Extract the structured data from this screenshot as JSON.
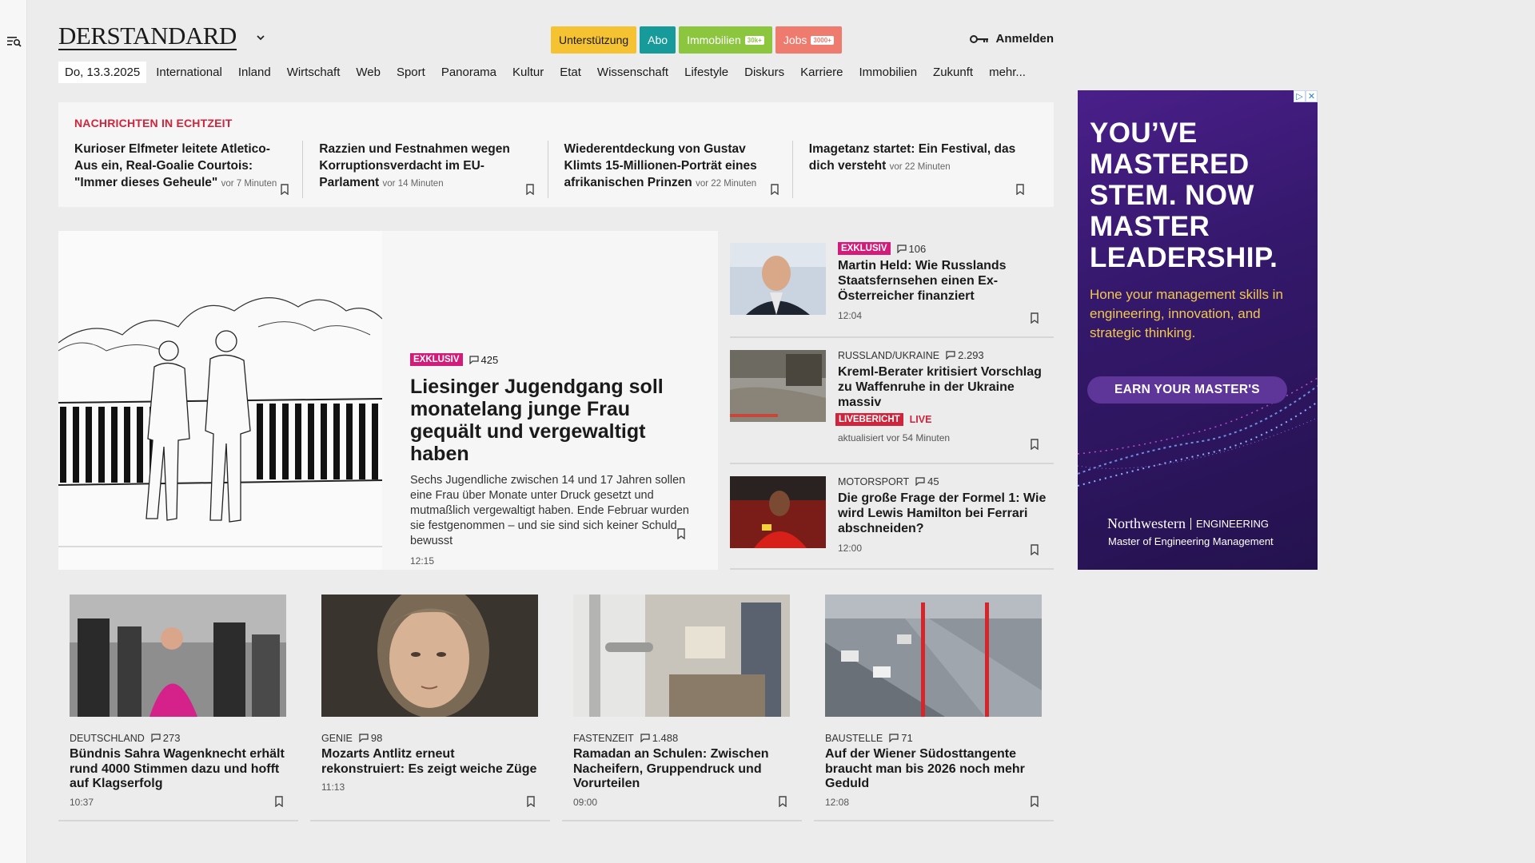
{
  "header": {
    "logo": "DERSTANDARD",
    "pills": [
      {
        "label": "Unterstützung",
        "bg": "#f5c332",
        "fg": "#1a1a1a",
        "tag": ""
      },
      {
        "label": "Abo",
        "bg": "#179a9a",
        "fg": "#ffffff",
        "tag": ""
      },
      {
        "label": "Immobilien",
        "bg": "#8cc63f",
        "fg": "#ffffff",
        "tag": "30k+"
      },
      {
        "label": "Jobs",
        "bg": "#ef7a6e",
        "fg": "#ffffff",
        "tag": "3000+"
      }
    ],
    "login_label": "Anmelden"
  },
  "nav": {
    "date": "Do, 13.3.2025",
    "items": [
      "International",
      "Inland",
      "Wirtschaft",
      "Web",
      "Sport",
      "Panorama",
      "Kultur",
      "Etat",
      "Wissenschaft",
      "Lifestyle",
      "Diskurs",
      "Karriere",
      "Immobilien",
      "Zukunft",
      "mehr..."
    ]
  },
  "ticker": {
    "title": "NACHRICHTEN IN ECHTZEIT",
    "items": [
      {
        "title": "Kurioser Elfmeter leitete Atletico-Aus ein, Real-Goalie Courtois: \"Immer dieses Geheule\"",
        "time": "vor 7 Minuten"
      },
      {
        "title": "Razzien und Festnahmen wegen Korruptionsverdacht im EU-Parlament",
        "time": "vor 14 Minuten"
      },
      {
        "title": "Wiederentdeckung von Gustav Klimts 15-Millionen-Porträt eines afrikanischen Prinzen",
        "time": "vor 22 Minuten"
      },
      {
        "title": "Imagetanz startet: Ein Festival, das dich versteht",
        "time": "vor 22 Minuten"
      }
    ]
  },
  "lead": {
    "badge": "EXKLUSIV",
    "comments": "425",
    "title": "Liesinger Jugendgang soll monatelang junge Frau gequält und vergewaltigt haben",
    "teaser": "Sechs Jugendliche zwischen 14 und 17 Jahren sollen eine Frau über Monate unter Druck gesetzt und mutmaßlich vergewaltigt haben. Ende Februar wurden sie festgenommen – und sie sind sich keiner Schuld bewusst",
    "time": "12:15"
  },
  "side": [
    {
      "badge": "EXKLUSIV",
      "kicker": "",
      "comments": "106",
      "title": "Martin Held: Wie Russlands Staatsfernsehen einen Ex-Österreicher finanziert",
      "meta": "12:04",
      "live": false
    },
    {
      "badge": "",
      "kicker": "RUSSLAND/UKRAINE",
      "comments": "2.293",
      "title": "Kreml-Berater kritisiert Vorschlag zu Waffenruhe in der Ukraine massiv",
      "meta": "aktualisiert vor 54 Minuten",
      "live": true,
      "live_badge": "LIVEBERICHT",
      "live_text": "LIVE"
    },
    {
      "badge": "",
      "kicker": "MOTORSPORT",
      "comments": "45",
      "title": "Die große Frage der Formel 1: Wie wird Lewis Hamilton bei Ferrari abschneiden?",
      "meta": "12:00",
      "live": false
    }
  ],
  "cards": [
    {
      "kicker": "DEUTSCHLAND",
      "comments": "273",
      "title": "Bündnis Sahra Wagenknecht erhält rund 4000 Stimmen dazu und hofft auf Klagserfolg",
      "meta": "10:37"
    },
    {
      "kicker": "GENIE",
      "comments": "98",
      "title": "Mozarts Antlitz erneut rekonstruiert: Es zeigt weiche Züge",
      "meta": "11:13"
    },
    {
      "kicker": "FASTENZEIT",
      "comments": "1.488",
      "title": "Ramadan an Schulen: Zwischen Nacheifern, Gruppendruck und Vorurteilen",
      "meta": "09:00"
    },
    {
      "kicker": "BAUSTELLE",
      "comments": "71",
      "title": "Auf der Wiener Südosttangente braucht man bis 2026 noch mehr Geduld",
      "meta": "12:08"
    }
  ],
  "ad": {
    "headline": "YOU’VE MASTERED STEM. NOW MASTER LEADERSHIP.",
    "sub": "Hone your management skills in engineering, innovation, and strategic thinking.",
    "button": "EARN YOUR MASTER'S",
    "brand": "Northwestern",
    "brand_unit": "ENGINEERING",
    "brand_program": "Master of Engineering Management"
  }
}
